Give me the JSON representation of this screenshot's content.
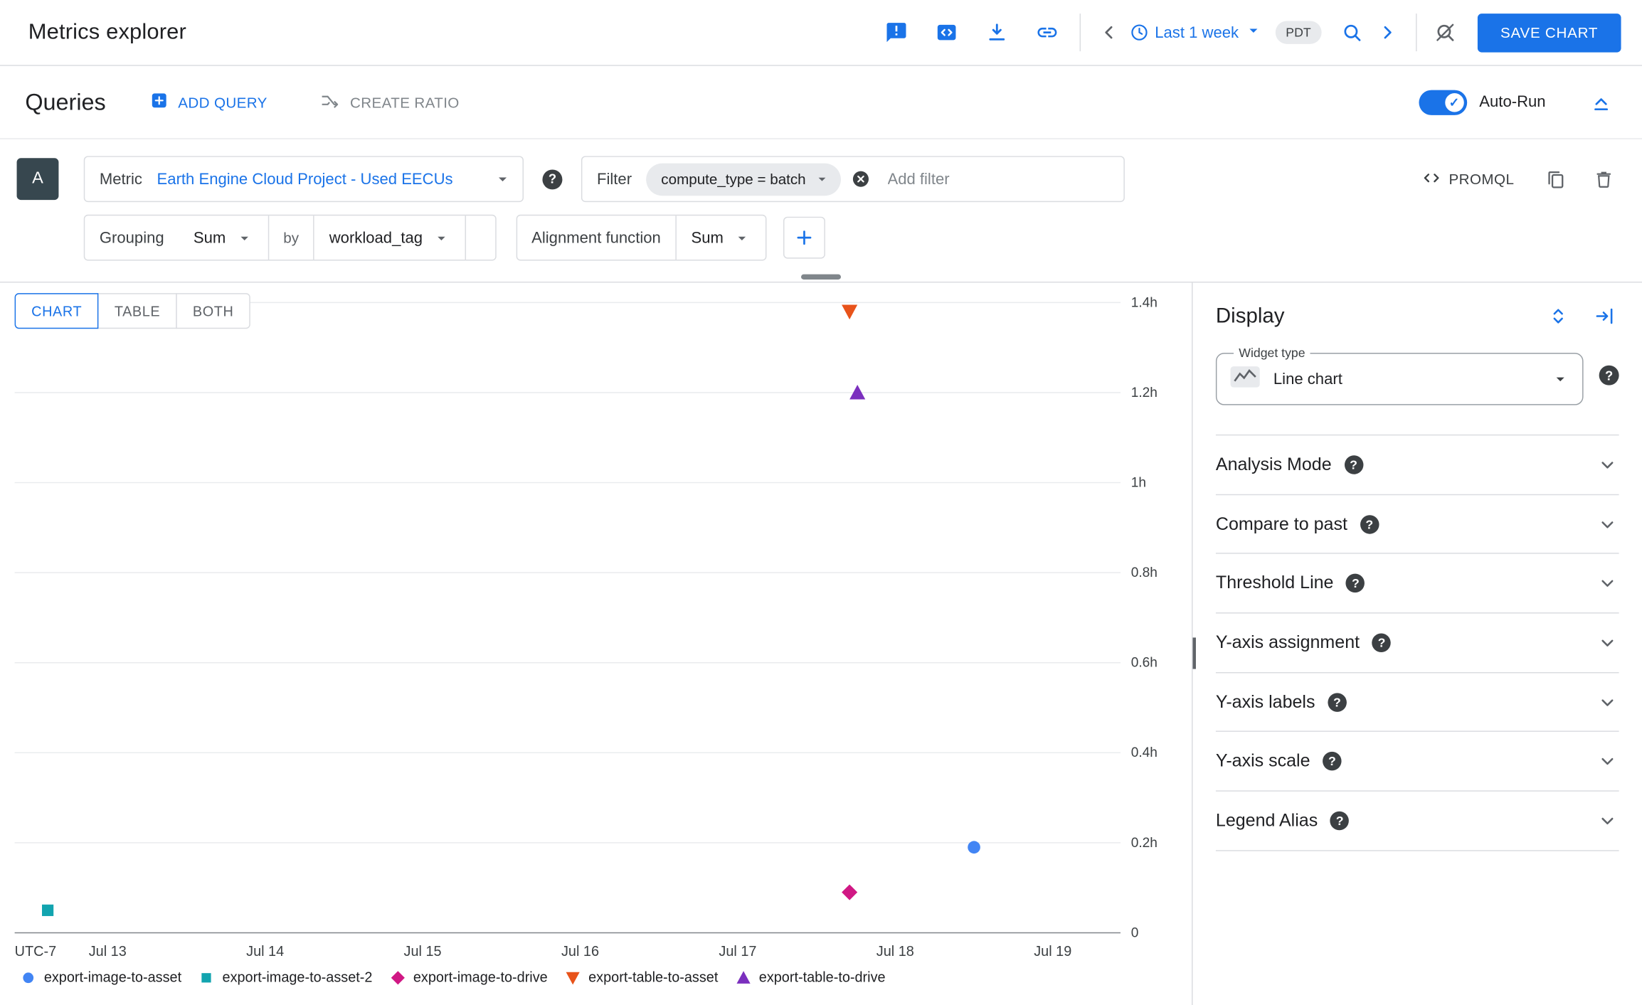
{
  "header": {
    "title": "Metrics explorer",
    "time_range": "Last 1 week",
    "timezone": "PDT",
    "save_button": "SAVE CHART"
  },
  "queries_bar": {
    "title": "Queries",
    "add_query": "ADD QUERY",
    "create_ratio": "CREATE RATIO",
    "auto_run_label": "Auto-Run"
  },
  "query": {
    "id": "A",
    "metric_label": "Metric",
    "metric_value": "Earth Engine Cloud Project - Used EECUs",
    "filter_label": "Filter",
    "filter_chip": "compute_type = batch",
    "add_filter_placeholder": "Add filter",
    "promql_label": "PROMQL",
    "grouping_label": "Grouping",
    "grouping_value": "Sum",
    "by_label": "by",
    "by_value": "workload_tag",
    "alignment_label": "Alignment function",
    "alignment_value": "Sum"
  },
  "view_tabs": [
    "CHART",
    "TABLE",
    "BOTH"
  ],
  "chart_data": {
    "type": "scatter",
    "title": "",
    "x_axis_prefix_label": "UTC-7",
    "x_ticks": [
      {
        "day": 13,
        "label": "Jul 13"
      },
      {
        "day": 14,
        "label": "Jul 14"
      },
      {
        "day": 15,
        "label": "Jul 15"
      },
      {
        "day": 16,
        "label": "Jul 16"
      },
      {
        "day": 17,
        "label": "Jul 17"
      },
      {
        "day": 18,
        "label": "Jul 18"
      },
      {
        "day": 19,
        "label": "Jul 19"
      }
    ],
    "xlim_days": [
      12.41,
      19.43
    ],
    "y_ticks": [
      {
        "value": 0,
        "label": "0"
      },
      {
        "value": 0.2,
        "label": "0.2h"
      },
      {
        "value": 0.4,
        "label": "0.4h"
      },
      {
        "value": 0.6,
        "label": "0.6h"
      },
      {
        "value": 0.8,
        "label": "0.8h"
      },
      {
        "value": 1.0,
        "label": "1h"
      },
      {
        "value": 1.2,
        "label": "1.2h"
      },
      {
        "value": 1.4,
        "label": "1.4h"
      }
    ],
    "ylim": [
      0,
      1.4
    ],
    "unit": "hours",
    "grid": true,
    "legend_position": "bottom",
    "series": [
      {
        "name": "export-image-to-asset",
        "marker": "circle",
        "color": "#4285F4",
        "points": [
          {
            "day": 18.5,
            "value": 0.19
          }
        ]
      },
      {
        "name": "export-image-to-asset-2",
        "marker": "square",
        "color": "#12A4AF",
        "points": [
          {
            "day": 12.62,
            "value": 0.05
          }
        ]
      },
      {
        "name": "export-image-to-drive",
        "marker": "diamond",
        "color": "#D01884",
        "points": [
          {
            "day": 17.71,
            "value": 0.09
          }
        ]
      },
      {
        "name": "export-table-to-asset",
        "marker": "triangle-down",
        "color": "#E8531A",
        "points": [
          {
            "day": 17.71,
            "value": 1.38
          }
        ]
      },
      {
        "name": "export-table-to-drive",
        "marker": "triangle-up",
        "color": "#7B2FBE",
        "points": [
          {
            "day": 17.76,
            "value": 1.2
          }
        ]
      }
    ]
  },
  "display_panel": {
    "title": "Display",
    "widget_type_label": "Widget type",
    "widget_type_value": "Line chart",
    "sections": [
      "Analysis Mode",
      "Compare to past",
      "Threshold Line",
      "Y-axis assignment",
      "Y-axis labels",
      "Y-axis scale",
      "Legend Alias"
    ]
  },
  "colors": {
    "accent": "#1a73e8",
    "border": "#dadce0",
    "text_primary": "#202124",
    "text_secondary": "#5f6368"
  }
}
